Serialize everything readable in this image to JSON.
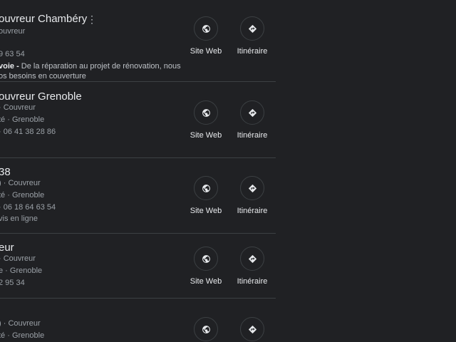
{
  "results": [
    {
      "title": "ouvreur Chambéry",
      "lines": [
        "ouvreur",
        "",
        "9 63 54"
      ],
      "desc_bold": "voie -",
      "desc_rest": " De la réparation au projet de rénovation, nous",
      "desc2": "os besoins en couverture",
      "website_label": "Site Web",
      "directions_label": "Itinéraire"
    },
    {
      "title": "ouvreur Grenoble",
      "lines": [
        "· Couvreur",
        "té · Grenoble",
        "· 06 41 38 28 86"
      ],
      "website_label": "Site Web",
      "directions_label": "Itinéraire"
    },
    {
      "title": "38",
      "lines": [
        ") · Couvreur",
        "té · Grenoble",
        "· 06 18 64 63 54",
        "vis en ligne"
      ],
      "website_label": "Site Web",
      "directions_label": "Itinéraire"
    },
    {
      "title": "eur",
      "lines": [
        "· Couvreur",
        "e · Grenoble",
        "2 95 34"
      ],
      "website_label": "Site Web",
      "directions_label": "Itinéraire"
    },
    {
      "title": "",
      "lines": [
        ") · Couvreur",
        "té · Grenoble"
      ],
      "website_label": "",
      "directions_label": ""
    }
  ],
  "icons": {
    "website": "globe-icon",
    "directions": "directions-icon",
    "more": "more-vert-icon"
  },
  "colors": {
    "background": "#202124",
    "title": "#e8eaed",
    "text": "#bdc1c6",
    "divider": "#3c4043"
  }
}
